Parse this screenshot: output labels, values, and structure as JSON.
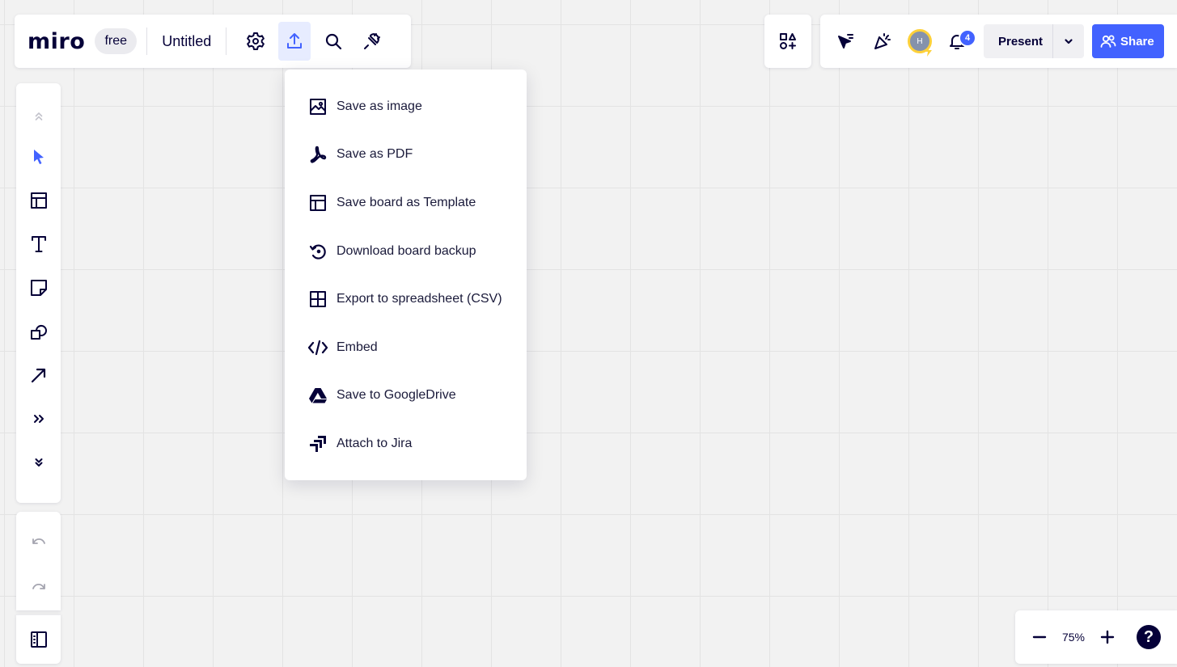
{
  "app": {
    "logo": "miro",
    "plan": "free",
    "board_title": "Untitled"
  },
  "toolbar_icons": [
    "settings-icon",
    "export-icon",
    "search-icon",
    "plugin-icon"
  ],
  "top_right": {
    "apps_icon": "apps-icon",
    "reactions_icons": [
      "cursor-follow-icon",
      "celebrate-icon"
    ],
    "avatar_initial": "H",
    "notifications_count": "4",
    "present_label": "Present",
    "share_label": "Share"
  },
  "left_tools": [
    "collapse-up-icon",
    "select-icon",
    "templates-icon",
    "text-icon",
    "sticky-note-icon",
    "shapes-icon",
    "arrow-icon",
    "more-tools-icon",
    "expand-down-icon"
  ],
  "export_menu": {
    "items": [
      {
        "label": "Save as image",
        "icon": "image-icon"
      },
      {
        "label": "Save as PDF",
        "icon": "pdf-icon"
      },
      {
        "label": "Save board as Template",
        "icon": "template-icon"
      },
      {
        "label": "Download board backup",
        "icon": "backup-icon"
      },
      {
        "label": "Export to spreadsheet (CSV)",
        "icon": "grid-icon"
      },
      {
        "label": "Embed",
        "icon": "embed-icon"
      },
      {
        "label": "Save to GoogleDrive",
        "icon": "google-drive-icon"
      },
      {
        "label": "Attach to Jira",
        "icon": "jira-icon"
      }
    ]
  },
  "zoom": {
    "value": "75%",
    "help": "?"
  },
  "colors": {
    "accent": "#4262ff",
    "ink": "#050038",
    "canvas": "#f2f2f2",
    "avatar_ring": "#fdd13a"
  }
}
